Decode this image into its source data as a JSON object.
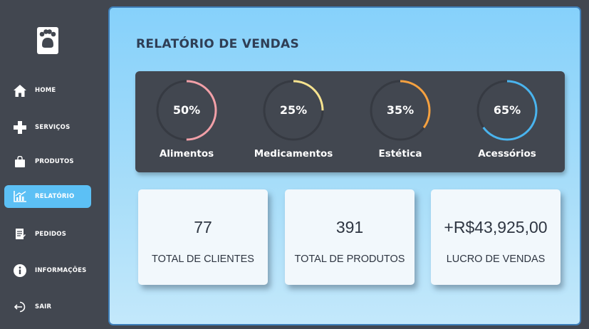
{
  "sidebar": {
    "logo_icon": "paw-icon",
    "items": [
      {
        "label": "HOME",
        "icon": "home-icon",
        "active": false
      },
      {
        "label": "SERVIÇOS",
        "icon": "plus-icon",
        "active": false
      },
      {
        "label": "PRODUTOS",
        "icon": "shopping-bag-icon",
        "active": false
      },
      {
        "label": "RELATÓRIO",
        "icon": "bar-chart-icon",
        "active": true
      },
      {
        "label": "PEDIDOS",
        "icon": "orders-icon",
        "active": false
      },
      {
        "label": "INFORMAÇÕES",
        "icon": "info-icon",
        "active": false
      },
      {
        "label": "SAIR",
        "icon": "logout-icon",
        "active": false
      }
    ]
  },
  "main": {
    "title": "RELATÓRIO DE VENDAS",
    "stats": [
      {
        "percent": "50%",
        "value": 50,
        "label": "Alimentos",
        "color": "#f2a0a8"
      },
      {
        "percent": "25%",
        "value": 25,
        "label": "Medicamentos",
        "color": "#f7e38f"
      },
      {
        "percent": "35%",
        "value": 35,
        "label": "Estética",
        "color": "#f5a140"
      },
      {
        "percent": "65%",
        "value": 65,
        "label": "Acessórios",
        "color": "#4ab4ee"
      }
    ],
    "cards": [
      {
        "value": "77",
        "label": "TOTAL DE CLIENTES"
      },
      {
        "value": "391",
        "label": "TOTAL DE PRODUTOS"
      },
      {
        "value": "+R$43,925,00",
        "label": "LUCRO DE VENDAS"
      }
    ]
  },
  "colors": {
    "sidebar_bg": "#424750",
    "active_item": "#5cc0f5",
    "panel_bg": "#424750",
    "ring_track": "#363a42"
  }
}
